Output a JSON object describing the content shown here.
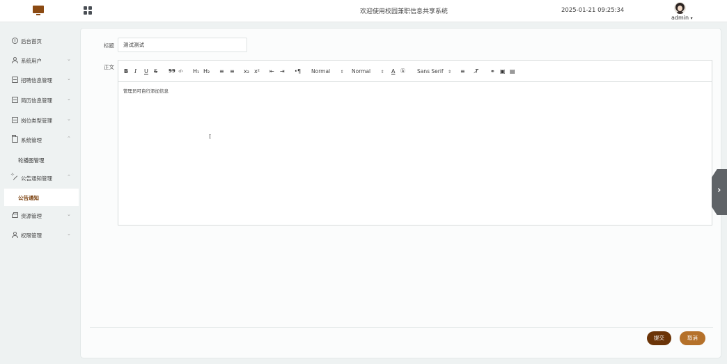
{
  "header": {
    "system_title": "欢迎使用校园兼职信息共享系统",
    "datetime": "2025-01-21 09:25:34",
    "username": "admin",
    "username_caret": "▾"
  },
  "sidebar": {
    "items": [
      {
        "label": "后台首页",
        "icon": "clock-icon"
      },
      {
        "label": "系统用户",
        "icon": "user-icon",
        "chevron": "⌄"
      },
      {
        "label": "招聘信息管理",
        "icon": "box-icon",
        "chevron": "⌄"
      },
      {
        "label": "简历信息管理",
        "icon": "box-icon",
        "chevron": "⌄"
      },
      {
        "label": "岗位类型管理",
        "icon": "box-icon",
        "chevron": "⌄"
      },
      {
        "label": "系统管理",
        "icon": "folder-icon",
        "chevron": "⌃"
      },
      {
        "label": "公告通知管理",
        "icon": "wand-icon",
        "chevron": "⌃"
      },
      {
        "label": "资源管理",
        "icon": "printer-icon",
        "chevron": "⌄"
      },
      {
        "label": "权限管理",
        "icon": "user-icon",
        "chevron": "⌄"
      }
    ],
    "sub_items": {
      "carousel": "轮播图管理",
      "notice": "公告通知"
    }
  },
  "form": {
    "title_label": "标题",
    "title_value": "测试测试",
    "body_label": "正文",
    "body_text": "管理员可自行添加信息",
    "submit_label": "提交",
    "cancel_label": "取消"
  },
  "toolbar": {
    "bold": "B",
    "italic": "I",
    "underline": "U",
    "strike": "S",
    "blockquote": "99",
    "code": "‹/›",
    "h1": "H₁",
    "h2": "H₂",
    "ordered_list": "≡",
    "bullet_list": "≡",
    "subscript": "x₂",
    "superscript": "x²",
    "indent_less": "⇤",
    "indent_more": "⇥",
    "direction": "⁌¶",
    "size_value": "Normal",
    "header_value": "Normal",
    "font_value": "Sans Serif",
    "select_caret": "⇕",
    "color": "A",
    "background": "Ⓐ",
    "align": "≡",
    "clean": "T̸",
    "link": "⚭",
    "image": "▣",
    "video": "▤"
  },
  "drawer": {
    "arrow": "›"
  }
}
